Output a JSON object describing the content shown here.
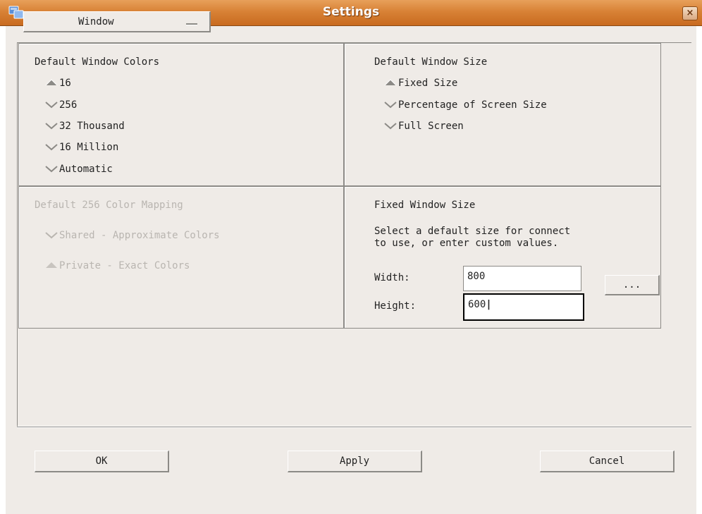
{
  "window": {
    "title": "Settings",
    "close_label": "×"
  },
  "category_menu": {
    "selected": "Window"
  },
  "colors_panel": {
    "title": "Default Window Colors",
    "options": [
      "16",
      "256",
      "32 Thousand",
      "16 Million",
      "Automatic"
    ],
    "selected": "16"
  },
  "size_panel": {
    "title": "Default Window Size",
    "options": [
      "Fixed Size",
      "Percentage of Screen Size",
      "Full Screen"
    ],
    "selected": "Fixed Size"
  },
  "mapping_panel": {
    "title": "Default 256 Color Mapping",
    "options": [
      "Shared - Approximate Colors",
      "Private - Exact Colors"
    ],
    "selected": "Private - Exact Colors",
    "enabled": false
  },
  "fixed_size_panel": {
    "title": "Fixed Window Size",
    "description_line1": "Select a default size for connect",
    "description_line2": "to use, or enter custom values.",
    "width_label": "Width:",
    "width_value": "800",
    "height_label": "Height:",
    "height_value": "600",
    "browse_label": "..."
  },
  "buttons": {
    "ok": "OK",
    "apply": "Apply",
    "cancel": "Cancel"
  },
  "colors": {
    "titlebar": "#d88236",
    "dialog_bg": "#efebe7",
    "disabled_text": "#b9b5b0"
  }
}
